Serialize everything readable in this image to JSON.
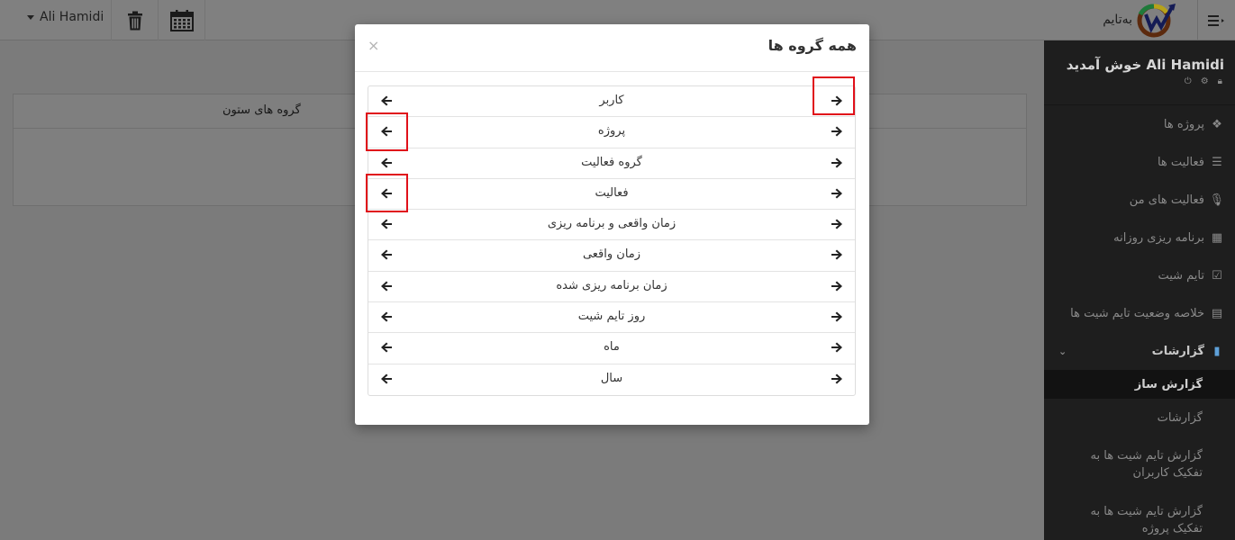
{
  "topbar": {
    "user_name": "Ali Hamidi",
    "logo_text": "بەتایم",
    "icons": [
      "trash-icon",
      "calendar-icon",
      "hamburger-icon"
    ]
  },
  "background": {
    "column_groups_label": "گروه های ستون"
  },
  "sidebar": {
    "welcome": "Ali Hamidi خوش آمدید",
    "items": [
      {
        "label": "پروژه ها",
        "icon": "cubes-icon"
      },
      {
        "label": "فعالیت ها",
        "icon": "list-icon"
      },
      {
        "label": "فعالیت های من",
        "icon": "mic-icon"
      },
      {
        "label": "برنامه ریزی روزانه",
        "icon": "table-icon"
      },
      {
        "label": "تایم شیت",
        "icon": "calendar-check-icon"
      },
      {
        "label": "خلاصه وضعیت تایم شیت ها",
        "icon": "list-alt-icon"
      },
      {
        "label": "گزارشات",
        "icon": "file-icon"
      }
    ],
    "sub_items": [
      {
        "label": "گزارش ساز",
        "active": true
      },
      {
        "label": "گزارشات",
        "active": false
      },
      {
        "label": "گزارش تایم شیت ها به تفکیک کاربران",
        "active": false
      },
      {
        "label": "گزارش تایم شیت ها به تفکیک پروژه",
        "active": false
      }
    ]
  },
  "modal": {
    "title": "همه گروه ها",
    "close": "×",
    "groups": [
      {
        "label": "کاربر"
      },
      {
        "label": "پروژه"
      },
      {
        "label": "گروه فعالیت"
      },
      {
        "label": "فعالیت"
      },
      {
        "label": "زمان واقعی و برنامه ریزی"
      },
      {
        "label": "زمان واقعی"
      },
      {
        "label": "زمان برنامه ریزی شده"
      },
      {
        "label": "روز تایم شیت"
      },
      {
        "label": "ماه"
      },
      {
        "label": "سال"
      }
    ]
  },
  "colors": {
    "highlight": "#e0101a",
    "overlay": "#7b7b7b",
    "sidebar_bg": "#1e1e1e",
    "accent": "#5ea0d8"
  }
}
